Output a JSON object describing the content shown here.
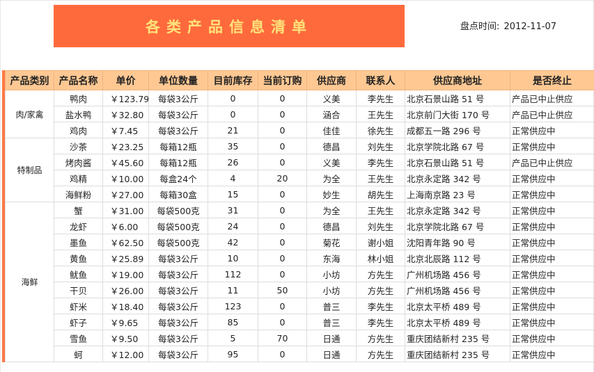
{
  "title": "各类产品信息清单",
  "check_time": {
    "label": "盘点时间:",
    "value": "2012-11-07"
  },
  "columns": [
    "产品类别",
    "产品名称",
    "单价",
    "单位数量",
    "目前库存",
    "当前订购",
    "供应商",
    "联系人",
    "供应商地址",
    "是否终止"
  ],
  "groups": [
    {
      "category": "肉/家禽",
      "rows": [
        {
          "name": "鸭肉",
          "price": "￥123.79",
          "unit": "每袋3公斤",
          "stock": "0",
          "order": "0",
          "supplier": "义美",
          "contact": "李先生",
          "address": "北京石景山路 51 号",
          "status": "产品已中止供应"
        },
        {
          "name": "盐水鸭",
          "price": "￥32.80",
          "unit": "每袋3公斤",
          "stock": "0",
          "order": "0",
          "supplier": "涵合",
          "contact": "王先生",
          "address": "北京前门大街 170 号",
          "status": "产品已中止供应"
        },
        {
          "name": "鸡肉",
          "price": "￥7.45",
          "unit": "每袋3公斤",
          "stock": "21",
          "order": "0",
          "supplier": "佳佳",
          "contact": "徐先生",
          "address": "成都五一路 296 号",
          "status": "正常供应中"
        }
      ]
    },
    {
      "category": "特制品",
      "rows": [
        {
          "name": "沙茶",
          "price": "￥23.25",
          "unit": "每箱12瓶",
          "stock": "35",
          "order": "0",
          "supplier": "德昌",
          "contact": "刘先生",
          "address": "北京学院北路 67 号",
          "status": "正常供应中"
        },
        {
          "name": "烤肉酱",
          "price": "￥45.60",
          "unit": "每箱12瓶",
          "stock": "26",
          "order": "0",
          "supplier": "义美",
          "contact": "李先生",
          "address": "北京石景山路 51 号",
          "status": "产品已中止供应"
        },
        {
          "name": "鸡精",
          "price": "￥10.00",
          "unit": "每盒24个",
          "stock": "4",
          "order": "20",
          "supplier": "为全",
          "contact": "王先生",
          "address": "北京永定路 342 号",
          "status": "正常供应中"
        },
        {
          "name": "海鲜粉",
          "price": "￥27.00",
          "unit": "每箱30盒",
          "stock": "15",
          "order": "0",
          "supplier": "妙生",
          "contact": "胡先生",
          "address": "上海南京路 23 号",
          "status": "正常供应中"
        }
      ]
    },
    {
      "category": "海鲜",
      "rows": [
        {
          "name": "蟹",
          "price": "￥31.00",
          "unit": "每袋500克",
          "stock": "31",
          "order": "0",
          "supplier": "为全",
          "contact": "王先生",
          "address": "北京永定路 342 号",
          "status": "正常供应中"
        },
        {
          "name": "龙虾",
          "price": "￥6.00",
          "unit": "每袋500克",
          "stock": "24",
          "order": "0",
          "supplier": "德昌",
          "contact": "刘先生",
          "address": "北京学院北路 67 号",
          "status": "正常供应中"
        },
        {
          "name": "墨鱼",
          "price": "￥62.50",
          "unit": "每袋500克",
          "stock": "42",
          "order": "0",
          "supplier": "菊花",
          "contact": "谢小姐",
          "address": "沈阳青年路 90 号",
          "status": "正常供应中"
        },
        {
          "name": "黄鱼",
          "price": "￥25.89",
          "unit": "每袋3公斤",
          "stock": "10",
          "order": "0",
          "supplier": "东海",
          "contact": "林小姐",
          "address": "北京北辰路 112 号",
          "status": "正常供应中"
        },
        {
          "name": "鱿鱼",
          "price": "￥19.00",
          "unit": "每袋3公斤",
          "stock": "112",
          "order": "0",
          "supplier": "小坊",
          "contact": "方先生",
          "address": "广州机场路 456 号",
          "status": "正常供应中"
        },
        {
          "name": "干贝",
          "price": "￥26.00",
          "unit": "每袋3公斤",
          "stock": "11",
          "order": "50",
          "supplier": "小坊",
          "contact": "方先生",
          "address": "广州机场路 456 号",
          "status": "正常供应中"
        },
        {
          "name": "虾米",
          "price": "￥18.40",
          "unit": "每袋3公斤",
          "stock": "123",
          "order": "0",
          "supplier": "普三",
          "contact": "李先生",
          "address": "北京太平桥 489 号",
          "status": "正常供应中"
        },
        {
          "name": "虾子",
          "price": "￥9.65",
          "unit": "每袋3公斤",
          "stock": "85",
          "order": "0",
          "supplier": "普三",
          "contact": "李先生",
          "address": "北京太平桥 489 号",
          "status": "正常供应中"
        },
        {
          "name": "雪鱼",
          "price": "￥9.50",
          "unit": "每袋3公斤",
          "stock": "5",
          "order": "70",
          "supplier": "日通",
          "contact": "方先生",
          "address": "重庆团结新村 235 号",
          "status": "正常供应中"
        },
        {
          "name": "蚵",
          "price": "￥12.00",
          "unit": "每袋3公斤",
          "stock": "95",
          "order": "0",
          "supplier": "日通",
          "contact": "方先生",
          "address": "重庆团结新村 235 号",
          "status": "正常供应中"
        }
      ]
    }
  ]
}
